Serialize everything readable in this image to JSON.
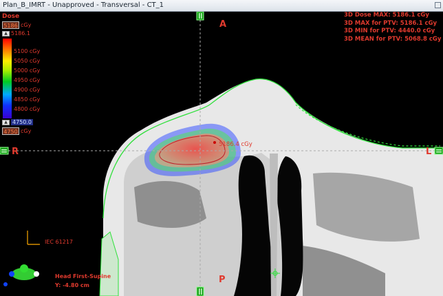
{
  "window": {
    "title": "Plan_B_IMRT  -  Unapproved - Transversal - CT_1"
  },
  "legend": {
    "title": "Dose",
    "max_box": "5186",
    "min_box": "4750",
    "unit": "cGy",
    "max_spin": "5186.1",
    "min_spin": "4750.0",
    "levels": [
      "5100 cGy",
      "5050 cGy",
      "5000 cGy",
      "4950 cGy",
      "4900 cGy",
      "4850 cGy",
      "4800 cGy"
    ]
  },
  "stats": [
    "3D Dose MAX: 5186.1 cGy",
    "3D MAX for PTV: 5186.1 cGy",
    "3D MIN for PTV: 4440.0 cGy",
    "3D MEAN for PTV: 5068.8 cGy"
  ],
  "orientation": {
    "anterior": "A",
    "posterior": "P",
    "right": "R",
    "left": "L"
  },
  "point_label": "5186.4 cGy",
  "iec_label": "IEC 61217",
  "patient_position": "Head First-Supine",
  "y_coord": "Y: -4.80 cm",
  "colors": {
    "label_red": "#e03a2e",
    "body_outline": "#2ee03a",
    "crosshair": "#aaaaaa"
  },
  "icons": [
    "close-icon",
    "spin-up-icon",
    "patient-orientation-icon",
    "plan-isocenter-icon",
    "crosshair-handle-icon"
  ]
}
